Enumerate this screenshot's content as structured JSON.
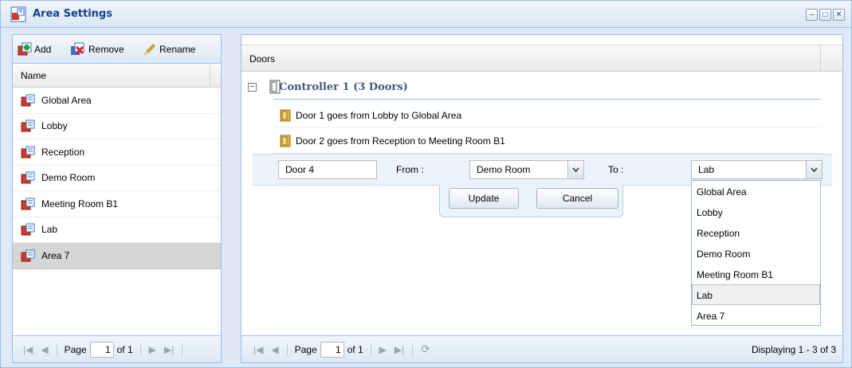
{
  "window": {
    "title": "Area Settings"
  },
  "left": {
    "toolbar": {
      "add_label": "Add",
      "remove_label": "Remove",
      "rename_label": "Rename"
    },
    "column_header": "Name",
    "areas": [
      {
        "label": "Global Area",
        "selected": false
      },
      {
        "label": "Lobby",
        "selected": false
      },
      {
        "label": "Reception",
        "selected": false
      },
      {
        "label": "Demo Room",
        "selected": false
      },
      {
        "label": "Meeting Room B1",
        "selected": false
      },
      {
        "label": "Lab",
        "selected": false
      },
      {
        "label": "Area 7",
        "selected": true
      }
    ],
    "pager": {
      "page_label": "Page",
      "page_value": "1",
      "of_label": "of 1"
    }
  },
  "right": {
    "column_header": "Doors",
    "group": {
      "toggle": "⊟",
      "title": "Controller 1 (3 Doors)"
    },
    "doors": [
      {
        "label": "Door 1 goes from Lobby to Global Area"
      },
      {
        "label": "Door 2 goes from Reception to Meeting Room B1"
      }
    ],
    "editor": {
      "name_value": "Door 4",
      "from_label": "From :",
      "from_value": "Demo Room",
      "to_label": "To :",
      "to_value": "Lab",
      "update_label": "Update",
      "cancel_label": "Cancel"
    },
    "to_options": [
      {
        "label": "Global Area",
        "selected": false
      },
      {
        "label": "Lobby",
        "selected": false
      },
      {
        "label": "Reception",
        "selected": false
      },
      {
        "label": "Demo Room",
        "selected": false
      },
      {
        "label": "Meeting Room B1",
        "selected": false
      },
      {
        "label": "Lab",
        "selected": true
      },
      {
        "label": "Area 7",
        "selected": false
      }
    ],
    "pager": {
      "page_label": "Page",
      "page_value": "1",
      "of_label": "of 1",
      "displaying": "Displaying 1 - 3 of 3"
    }
  },
  "colors": {
    "panel_border": "#99bbe8",
    "title_text": "#15428b",
    "area_icon_red": "#d03a2a",
    "area_icon_blue": "#3a6fc4",
    "door_icon": "#e3b341"
  }
}
